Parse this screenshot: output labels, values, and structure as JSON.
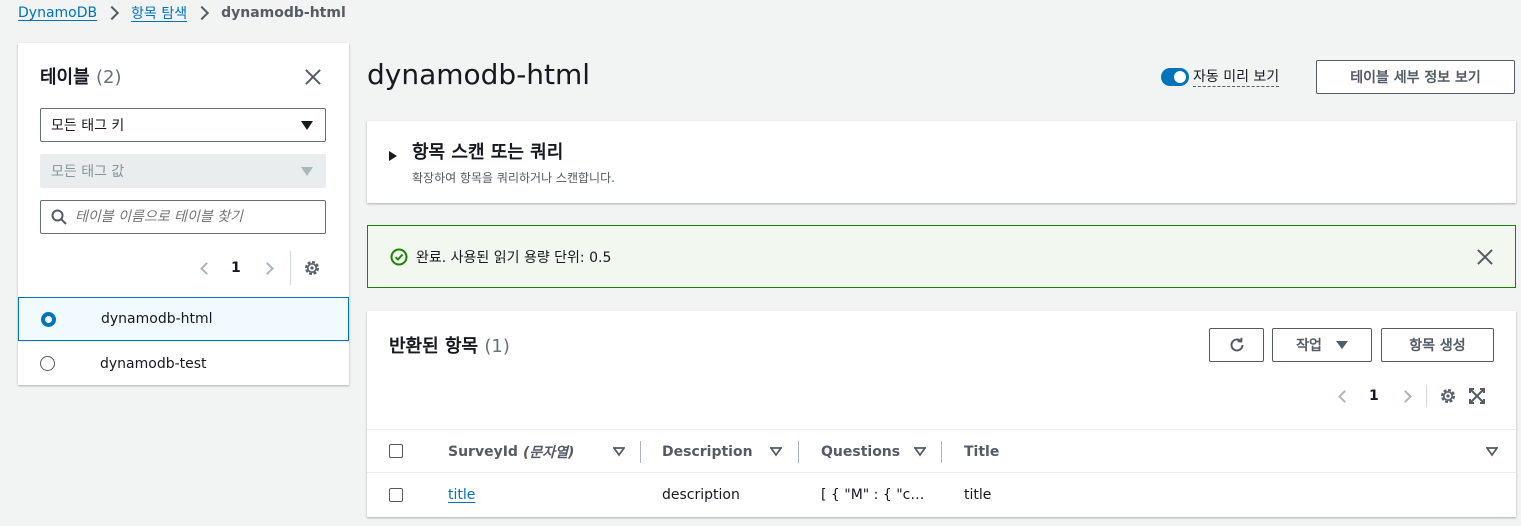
{
  "breadcrumb": {
    "items": [
      "DynamoDB",
      "항목 탐색"
    ],
    "current": "dynamodb-html"
  },
  "tables_panel": {
    "title": "테이블",
    "count": "(2)",
    "tag_key_select": "모든 태그 키",
    "tag_value_select": "모든 태그 값",
    "search_placeholder": "테이블 이름으로 테이블 찾기",
    "page": "1",
    "rows": [
      {
        "name": "dynamodb-html",
        "selected": true
      },
      {
        "name": "dynamodb-test",
        "selected": false
      }
    ]
  },
  "main": {
    "title": "dynamodb-html",
    "auto_preview_label": "자동 미리 보기",
    "view_details_button": "테이블 세부 정보 보기",
    "scan_expander": {
      "title": "항목 스캔 또는 쿼리",
      "description": "확장하여 항목을 쿼리하거나 스캔합니다."
    },
    "flash": {
      "message": "완료. 사용된 읽기 용량 단위: 0.5"
    },
    "items_section": {
      "title": "반환된 항목",
      "count": "(1)",
      "actions_button": "작업",
      "create_item_button": "항목 생성",
      "page": "1",
      "columns": [
        {
          "label": "SurveyId",
          "type_label": "(문자열)"
        },
        {
          "label": "Description"
        },
        {
          "label": "Questions"
        },
        {
          "label": "Title"
        }
      ],
      "rows": [
        {
          "SurveyId": "title",
          "Description": "description",
          "Questions": "[ { \"M\" : { \"c…",
          "Title": "title"
        }
      ]
    }
  },
  "colors": {
    "link": "#0073bb",
    "success_border": "#1d8102",
    "success_bg": "#f2f8f0",
    "selected_row_bg": "#f1faff"
  }
}
